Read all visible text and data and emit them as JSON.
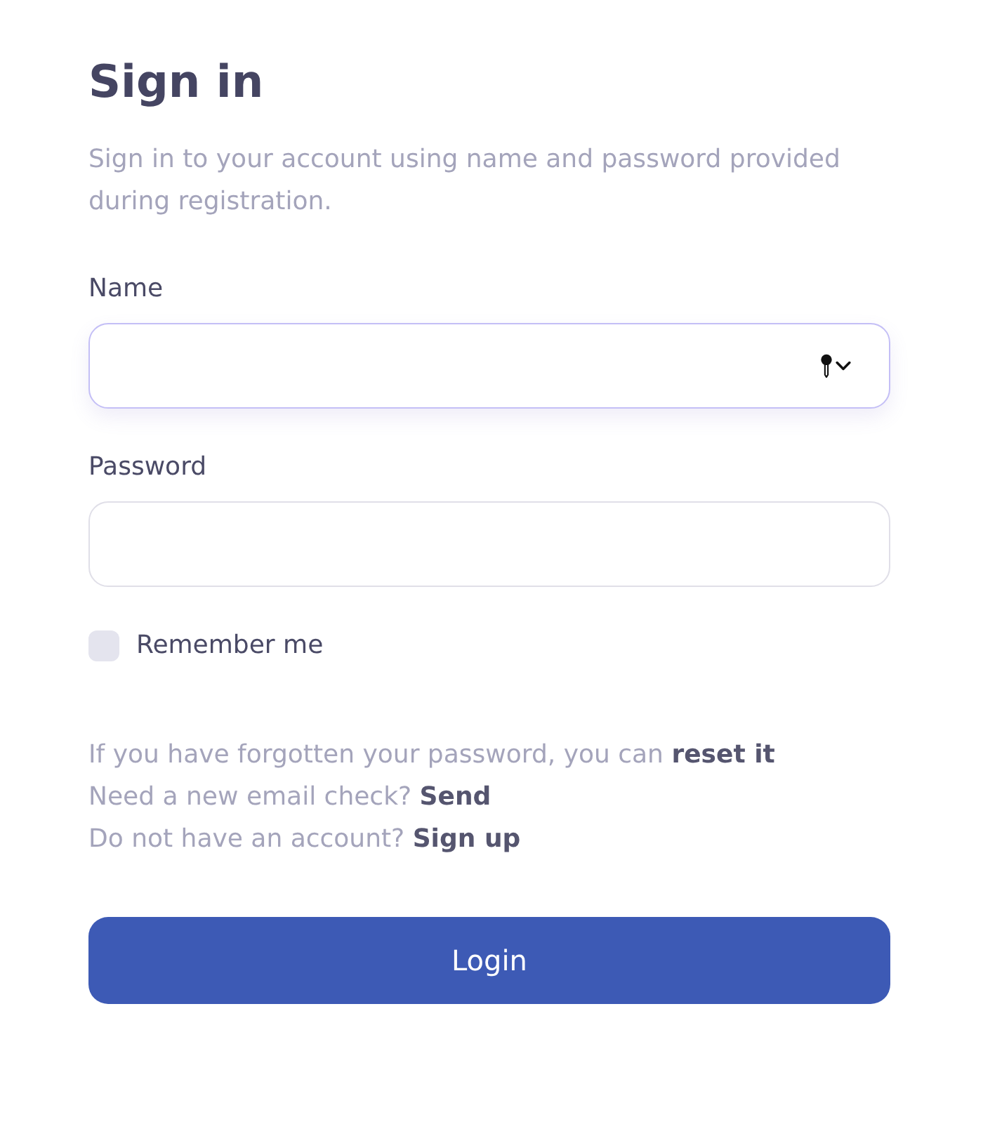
{
  "title": "Sign in",
  "description": "Sign in to your account using name and password provided during registration.",
  "fields": [
    {
      "label": "Name",
      "focused": true,
      "autofill_icon": true
    },
    {
      "label": "Password",
      "focused": false,
      "autofill_icon": false
    }
  ],
  "remember": {
    "label": "Remember me",
    "checked": false
  },
  "help_lines": [
    {
      "text": "If you have forgotten your password, you can",
      "link": "reset it"
    },
    {
      "text": "Need a new email check?",
      "link": "Send"
    },
    {
      "text": "Do not have an account?",
      "link": "Sign up"
    }
  ],
  "submit": {
    "label": "Login"
  }
}
